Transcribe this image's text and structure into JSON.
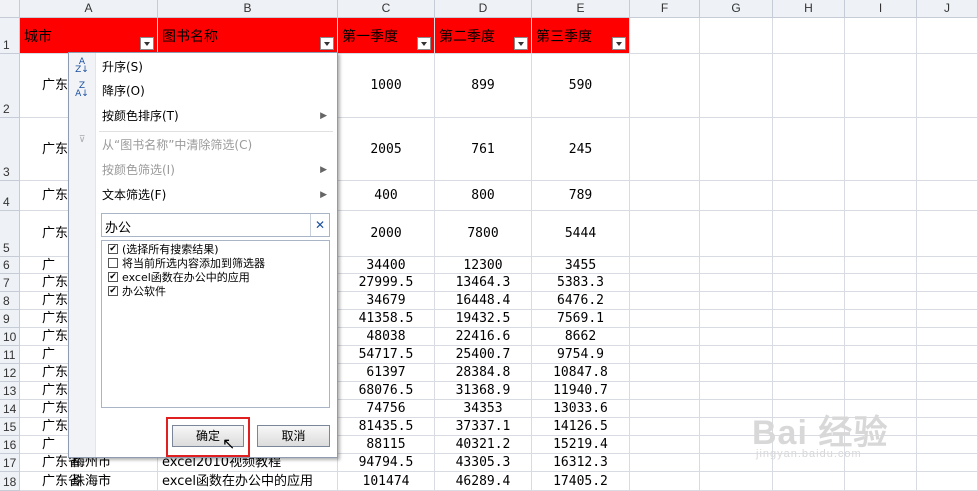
{
  "columns": [
    "A",
    "B",
    "C",
    "D",
    "E",
    "F",
    "G",
    "H",
    "I",
    "J"
  ],
  "rows": [
    "1",
    "2",
    "3",
    "4",
    "5",
    "6",
    "7",
    "8",
    "9",
    "10",
    "11",
    "12",
    "13",
    "14",
    "15",
    "16",
    "17",
    "18"
  ],
  "header": {
    "city": "城市",
    "book": "图书名称",
    "q1": "第一季度",
    "q2": "第二季度",
    "q3": "第三季度"
  },
  "colA": [
    "广东",
    "广东",
    "广东",
    "广东",
    "广",
    "广东",
    "广东",
    "广东",
    "广东",
    "广",
    "广东",
    "广东",
    "广东",
    "广东",
    "广",
    "广东省",
    "广东省"
  ],
  "tail": {
    "b17": "梅州市",
    "c17": "excel2010视频教程",
    "b18": "珠海市",
    "c18": "excel函数在办公中的应用"
  },
  "q1": [
    "1000",
    "2005",
    "400",
    "2000",
    "34400",
    "27999.5",
    "34679",
    "41358.5",
    "48038",
    "54717.5",
    "61397",
    "68076.5",
    "74756",
    "81435.5",
    "88115",
    "94794.5",
    "101474"
  ],
  "q2": [
    "899",
    "761",
    "800",
    "7800",
    "12300",
    "13464.3",
    "16448.4",
    "19432.5",
    "22416.6",
    "25400.7",
    "28384.8",
    "31368.9",
    "34353",
    "37337.1",
    "40321.2",
    "43305.3",
    "46289.4"
  ],
  "q3": [
    "590",
    "245",
    "789",
    "5444",
    "3455",
    "5383.3",
    "6476.2",
    "7569.1",
    "8662",
    "9754.9",
    "10847.8",
    "11940.7",
    "13033.6",
    "14126.5",
    "15219.4",
    "16312.3",
    "17405.2"
  ],
  "menu": {
    "sort_asc": "升序(S)",
    "sort_desc": "降序(O)",
    "sort_color": "按颜色排序(T)",
    "clear_filter": "从“图书名称”中清除筛选(C)",
    "color_filter": "按颜色筛选(I)",
    "text_filter": "文本筛选(F)",
    "search_value": "办公",
    "items": [
      {
        "label": "(选择所有搜索结果)",
        "checked": true
      },
      {
        "label": "将当前所选内容添加到筛选器",
        "checked": false
      },
      {
        "label": "excel函数在办公中的应用",
        "checked": true
      },
      {
        "label": "办公软件",
        "checked": true
      }
    ],
    "ok": "确定",
    "cancel": "取消"
  },
  "watermark": {
    "text": "Bai 经验",
    "url": "jingyan.baidu.com"
  },
  "colors": {
    "header_fill": "#ff0000",
    "highlight": "#e02020"
  }
}
